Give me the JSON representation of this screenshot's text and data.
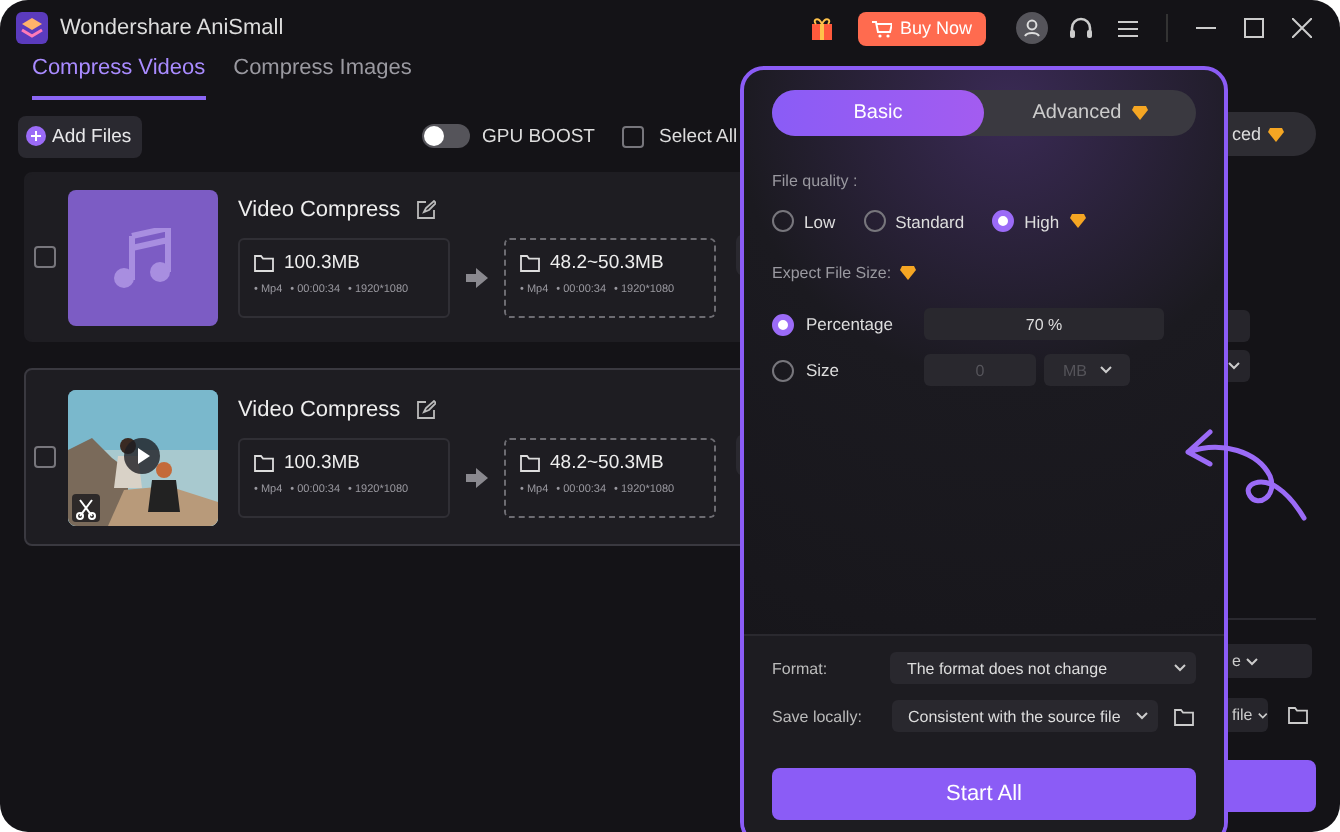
{
  "app": {
    "title": "Wondershare AniSmall",
    "buy_label": "Buy Now"
  },
  "tabs": [
    {
      "label": "Compress Videos",
      "selected": true
    },
    {
      "label": "Compress Images",
      "selected": false
    }
  ],
  "toolbar": {
    "add_files": "Add Files",
    "gpu_boost": {
      "label": "GPU BOOST",
      "on": false
    },
    "select_all": {
      "label": "Select All",
      "checked": false
    }
  },
  "files": [
    {
      "name": "Video Compress",
      "checked": false,
      "kind": "audio",
      "source": {
        "size": "100.3MB",
        "meta": [
          "• Mp4",
          "• 00:00:34",
          "• 1920*1080"
        ]
      },
      "output": {
        "size": "48.2~50.3MB",
        "meta": [
          "• Mp4",
          "• 00:00:34",
          "• 1920*1080"
        ]
      }
    },
    {
      "name": "Video Compress",
      "checked": false,
      "kind": "video",
      "source": {
        "size": "100.3MB",
        "meta": [
          "• Mp4",
          "• 00:00:34",
          "• 1920*1080"
        ]
      },
      "output": {
        "size": "48.2~50.3MB",
        "meta": [
          "• Mp4",
          "• 00:00:34",
          "• 1920*1080"
        ]
      }
    }
  ],
  "background_panel": {
    "tab_fragment": "ced",
    "format_fragment": "e",
    "save_fragment": "file"
  },
  "popup": {
    "tabs": [
      {
        "label": "Basic",
        "selected": true,
        "premium": false
      },
      {
        "label": "Advanced",
        "selected": false,
        "premium": true
      }
    ],
    "quality_label": "File quality :",
    "quality_options": [
      {
        "label": "Low",
        "selected": false,
        "premium": false
      },
      {
        "label": "Standard",
        "selected": false,
        "premium": false
      },
      {
        "label": "High",
        "selected": true,
        "premium": true
      }
    ],
    "size_label": "Expect File Size:",
    "size_options": [
      {
        "label": "Percentage",
        "selected": true,
        "kind": "percent",
        "value": "70 %"
      },
      {
        "label": "Size",
        "selected": false,
        "kind": "size",
        "value": "0",
        "unit": "MB"
      }
    ],
    "format_label": "Format:",
    "format_value": "The format does not change",
    "save_label": "Save locally:",
    "save_value": "Consistent with the source file",
    "start_label": "Start All"
  }
}
